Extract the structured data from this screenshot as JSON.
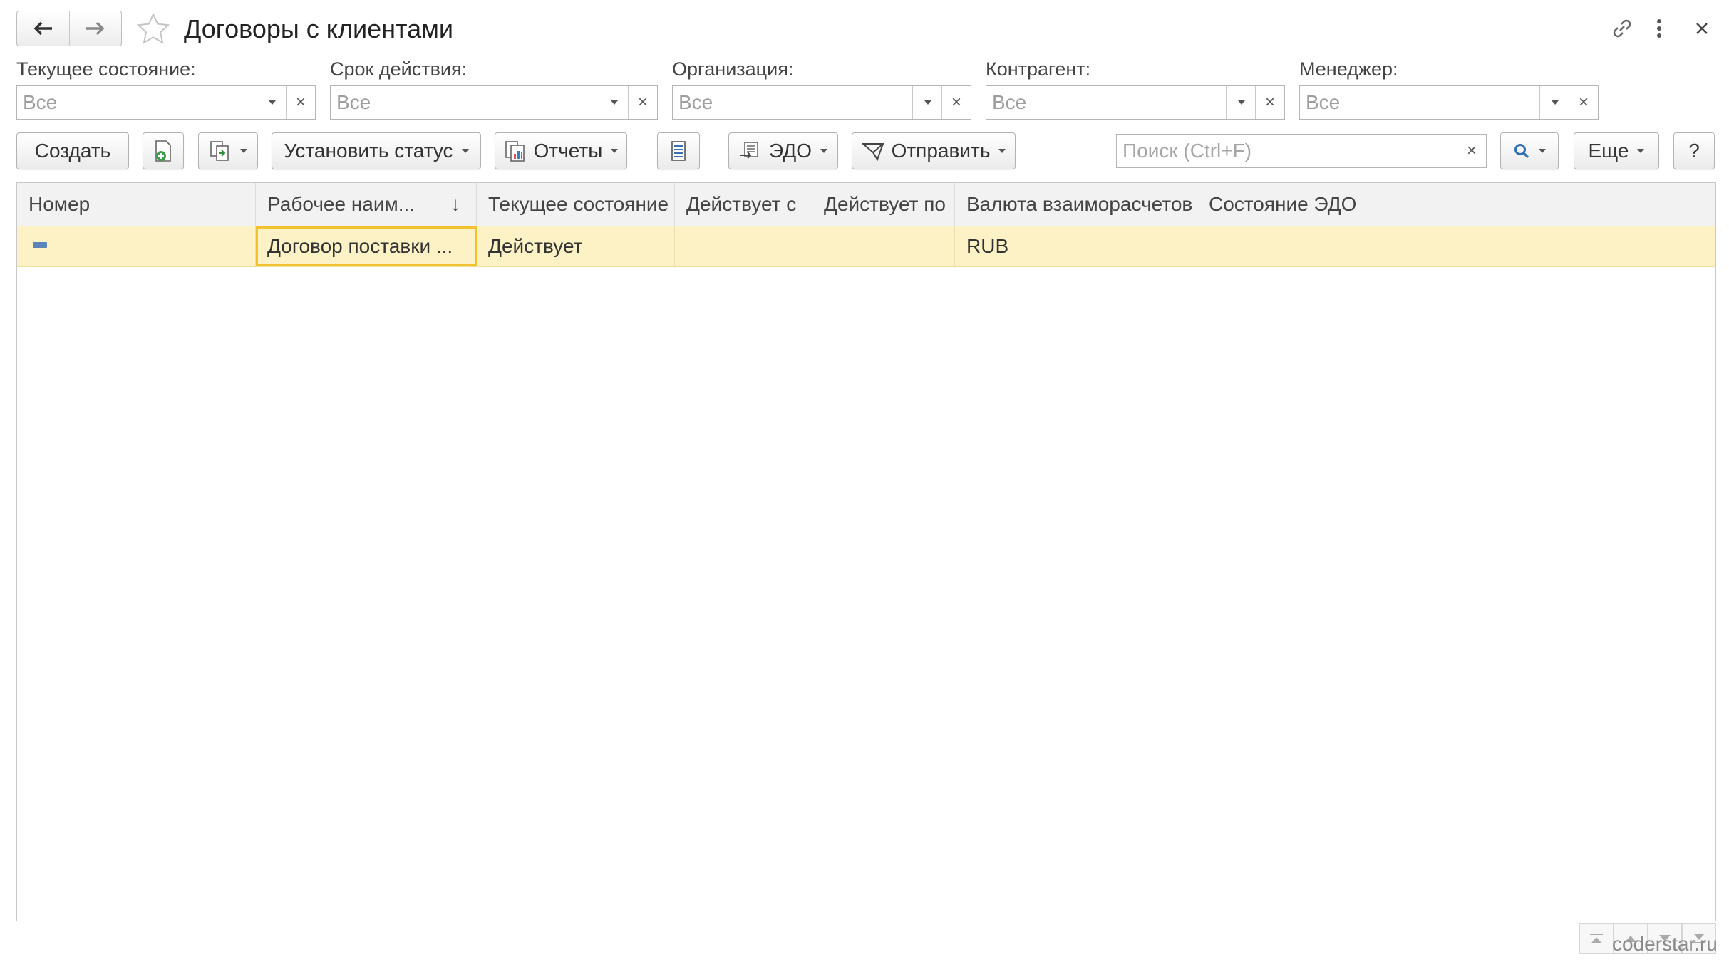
{
  "window": {
    "title": "Договоры с клиентами"
  },
  "filters": [
    {
      "label": "Текущее состояние:",
      "value": "Все"
    },
    {
      "label": "Срок действия:",
      "value": "Все"
    },
    {
      "label": "Организация:",
      "value": "Все"
    },
    {
      "label": "Контрагент:",
      "value": "Все"
    },
    {
      "label": "Менеджер:",
      "value": "Все"
    }
  ],
  "toolbar": {
    "create_label": "Создать",
    "set_status_label": "Установить статус",
    "reports_label": "Отчеты",
    "edo_label": "ЭДО",
    "send_label": "Отправить",
    "search_placeholder": "Поиск (Ctrl+F)",
    "more_label": "Еще",
    "help_label": "?"
  },
  "table": {
    "columns": [
      "Номер",
      "Рабочее наим...",
      "Текущее состояние",
      "Действует с",
      "Действует по",
      "Валюта взаиморасчетов",
      "Состояние ЭДО"
    ],
    "sort_indicator": "↓",
    "rows": [
      {
        "number": "",
        "name": "Договор поставки ...",
        "state": "Действует",
        "from": "",
        "to": "",
        "currency": "RUB",
        "edo_state": ""
      }
    ]
  },
  "watermark": "coderstar.ru",
  "colors": {
    "selected_row": "#fdf2c6",
    "focus_border": "#f2c12e",
    "header_bg": "#f2f2f2"
  }
}
